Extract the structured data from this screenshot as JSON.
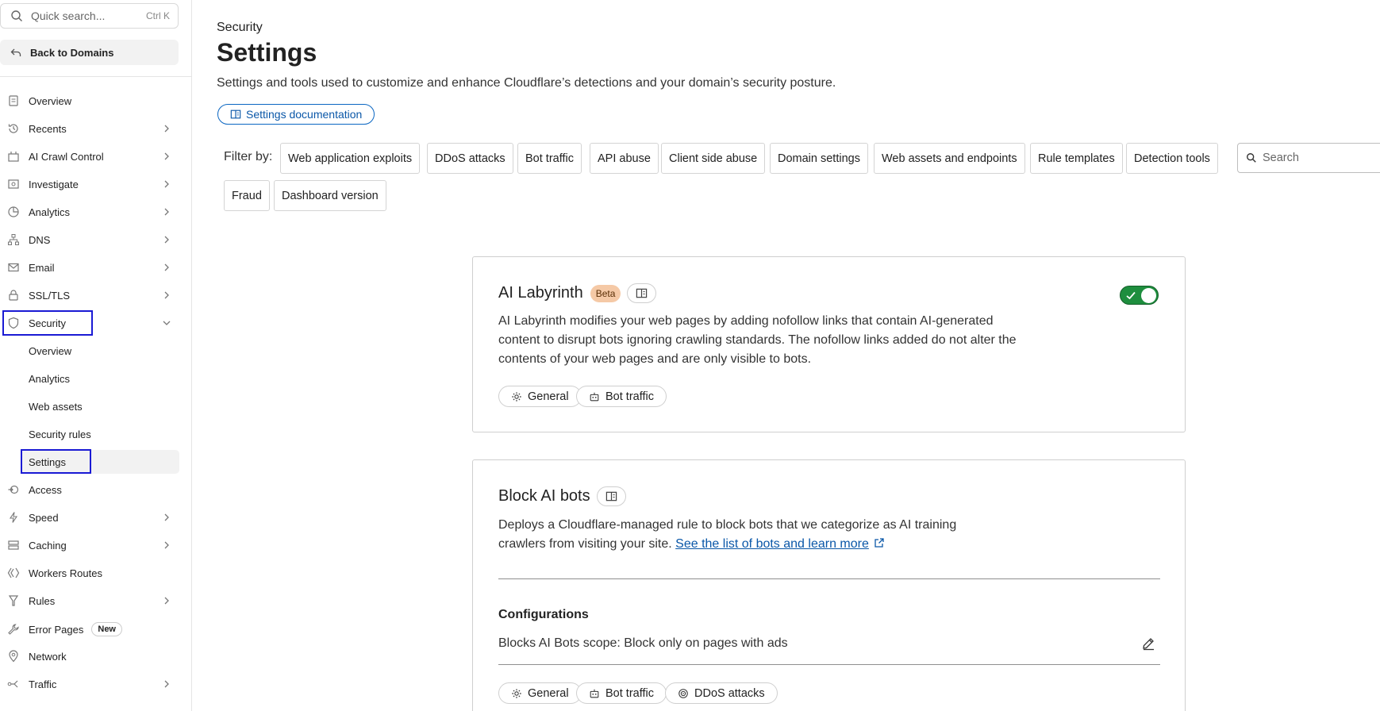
{
  "sidebar": {
    "quick_search_placeholder": "Quick search...",
    "quick_search_shortcut": "Ctrl K",
    "back_label": "Back to Domains",
    "items": [
      {
        "label": "Overview",
        "icon": "document-icon"
      },
      {
        "label": "Recents",
        "icon": "history-icon"
      },
      {
        "label": "AI Crawl Control",
        "icon": "crawl-icon"
      },
      {
        "label": "Investigate",
        "icon": "investigate-icon"
      },
      {
        "label": "Analytics",
        "icon": "chart-pie-icon"
      },
      {
        "label": "DNS",
        "icon": "network-tree-icon"
      },
      {
        "label": "Email",
        "icon": "email-icon"
      },
      {
        "label": "SSL/TLS",
        "icon": "lock-icon"
      },
      {
        "label": "Security",
        "icon": "shield-icon"
      },
      {
        "label": "Access",
        "icon": "access-icon"
      },
      {
        "label": "Speed",
        "icon": "bolt-icon"
      },
      {
        "label": "Caching",
        "icon": "storage-icon"
      },
      {
        "label": "Workers Routes",
        "icon": "workers-icon"
      },
      {
        "label": "Rules",
        "icon": "rules-icon"
      },
      {
        "label": "Error Pages",
        "icon": "wrench-icon"
      },
      {
        "label": "Network",
        "icon": "location-icon"
      },
      {
        "label": "Traffic",
        "icon": "traffic-icon"
      }
    ],
    "security_sub": [
      "Overview",
      "Analytics",
      "Web assets",
      "Security rules",
      "Settings"
    ],
    "new_badge": "New"
  },
  "page": {
    "breadcrumb": "Security",
    "title": "Settings",
    "subtitle": "Settings and tools used to customize and enhance Cloudflare’s detections and your domain’s security posture.",
    "doc_button": "Settings documentation"
  },
  "filters": {
    "label": "Filter by:",
    "chips": [
      "Web application exploits",
      "DDoS attacks",
      "Bot traffic",
      "API abuse",
      "Client side abuse",
      "Domain settings",
      "Web assets and endpoints",
      "Rule templates",
      "Detection tools",
      "Fraud",
      "Dashboard version"
    ],
    "search_placeholder": "Search"
  },
  "cards": {
    "labyrinth": {
      "title": "AI Labyrinth",
      "badge": "Beta",
      "description": "AI Labyrinth modifies your web pages by adding nofollow links that contain AI-generated content to disrupt bots ignoring crawling standards. The nofollow links added do not alter the contents of your web pages and are only visible to bots.",
      "enabled": true,
      "tags": [
        "General",
        "Bot traffic"
      ]
    },
    "block_ai": {
      "title": "Block AI bots",
      "description": "Deploys a Cloudflare-managed rule to block bots that we categorize as AI training crawlers from visiting your site.",
      "link_text": "See the list of bots and learn more",
      "config_title": "Configurations",
      "config_value": "Blocks AI Bots scope: Block only on pages with ads",
      "tags": [
        "General",
        "Bot traffic",
        "DDoS attacks"
      ]
    }
  },
  "colors": {
    "accent_link": "#0a57a8",
    "toggle_on": "#1e8e3e",
    "beta_badge": "#f5c9a6",
    "focus_outline": "#1a1ad4"
  }
}
